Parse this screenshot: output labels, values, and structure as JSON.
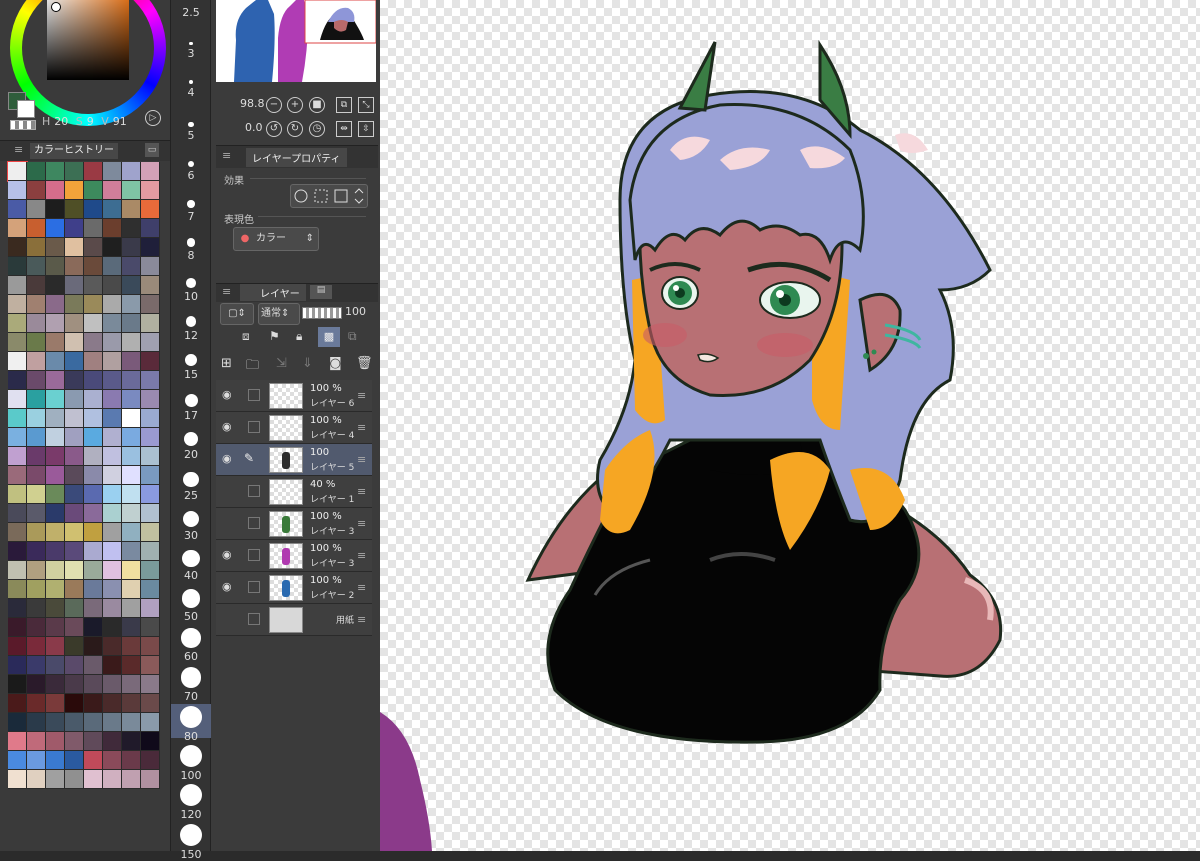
{
  "color_panel": {
    "h_label": "H",
    "h_value": "20",
    "s_label": "S",
    "s_value": "9",
    "v_label": "V",
    "v_value": "91",
    "fg_color": "#2f5d3b",
    "bg_color": "#ffffff"
  },
  "color_history": {
    "tab_label": "カラーヒストリー",
    "swatches": [
      "#eeeeee",
      "#2c6a4a",
      "#3e8760",
      "#3c6f54",
      "#9a3a44",
      "#7e8a9c",
      "#9fa3cc",
      "#d3a1b7",
      "#b6c0e8",
      "#8b3f3f",
      "#d56d8b",
      "#f2a33a",
      "#3d8a5d",
      "#d07e9a",
      "#7fc3a5",
      "#e29aa1",
      "#4a5ba6",
      "#888888",
      "#1d1d1d",
      "#4f4f26",
      "#1f4a8a",
      "#3d6d92",
      "#aa8a66",
      "#e86a3a",
      "#d4a27a",
      "#c85f2f",
      "#2b6ee3",
      "#3f3f8a",
      "#6a6a6a",
      "#6b3e2d",
      "#2f2f2f",
      "#3f3f6a",
      "#3a2a1f",
      "#8a6f3a",
      "#6a5a4a",
      "#e0c0a0",
      "#5a4a4a",
      "#1f1f1f",
      "#3a3a4a",
      "#1f1f3a",
      "#2a3a3a",
      "#4a5a5a",
      "#5a5a4a",
      "#8a6a5a",
      "#6a4a3a",
      "#5a6a7a",
      "#4a4a6a",
      "#8a8a9a",
      "#9a9a9a",
      "#4a3a3a",
      "#2a2a2a",
      "#6a6a7a",
      "#5a5a5a",
      "#4a4a4a",
      "#3a4a5a",
      "#9a8a7a",
      "#c0b0a0",
      "#a08070",
      "#8a6a8a",
      "#7a7a5a",
      "#9a8a5a",
      "#aaaaaa",
      "#8a9aaa",
      "#7a6a6a",
      "#aaaa7a",
      "#9a8a9a",
      "#b0a0b0",
      "#a09080",
      "#c0c0c0",
      "#7a8a9a",
      "#6a7a8a",
      "#b0b0a0",
      "#8a8a6a",
      "#6a7a4a",
      "#9a7a6a",
      "#d0c0b0",
      "#8a7a8a",
      "#9a9aaa",
      "#b0b0b0",
      "#a0a0b0",
      "#f0f0f0",
      "#c0a0a0",
      "#6a8aaa",
      "#3a6aa0",
      "#a08080",
      "#b0a0a0",
      "#7a5a7a",
      "#5a2a3a",
      "#2a2a4a",
      "#6a4a6a",
      "#9a6a9a",
      "#3a3a5a",
      "#4a4a7a",
      "#5a5a8a",
      "#6a6a9a",
      "#7a7aaa",
      "#e0e0f0",
      "#2aa0a0",
      "#6ad0d0",
      "#8a9ab0",
      "#aab0d0",
      "#8a7ab0",
      "#7a8ac0",
      "#9a8ab0",
      "#5acaca",
      "#9ad0e0",
      "#a0b0c0",
      "#c0c0d0",
      "#b0c0e0",
      "#5a7ab0",
      "#ffffff",
      "#9aaad0",
      "#7ab0e0",
      "#5a9ad0",
      "#c0d0e0",
      "#a0a0c0",
      "#5aaae0",
      "#b0b0d0",
      "#7aaae0",
      "#9a9ad0",
      "#c0a0d0",
      "#6a3a6a",
      "#7a3a6a",
      "#8a5a8a",
      "#b0b0c0",
      "#c0c0e0",
      "#9ac0e0",
      "#aac0d0",
      "#9a6a7a",
      "#7a4a6a",
      "#9a5a9a",
      "#5a4a5a",
      "#8a8aaa",
      "#d0d0e0",
      "#e0e0ff",
      "#7a9ac0",
      "#c0c080",
      "#d0d090",
      "#6a8a5a",
      "#3a4a7a",
      "#5a6ab0",
      "#9ad0f0",
      "#c0e0f0",
      "#8a9ae0",
      "#4a4a5a",
      "#5a5a6a",
      "#2a3a6a",
      "#6a4a7a",
      "#8a6a9a",
      "#aad0d0",
      "#c0d0d0",
      "#b0c0d0",
      "#7a6a5a",
      "#aa9a5a",
      "#c0b06a",
      "#d0c070",
      "#c0a040",
      "#a0a0a0",
      "#90b0c0",
      "#c0c0a0",
      "#2a1a3a",
      "#3a2a5a",
      "#4a3a6a",
      "#5a4a7a",
      "#aaaad0",
      "#c0c0f0",
      "#7a8aa0",
      "#a0b0b0",
      "#c0c0b0",
      "#b0a080",
      "#d0d0a0",
      "#e0e0b0",
      "#9aaa9a",
      "#e0c0e0",
      "#f0e0a0",
      "#7a9a9a",
      "#8a8a5a",
      "#a0a060",
      "#b0b070",
      "#9a7a5a",
      "#6a7a9a",
      "#8a90b0",
      "#e0d0b0",
      "#6a8aa0",
      "#2a2a3a",
      "#3a3a3a",
      "#4a4a3a",
      "#5a6a5a",
      "#7a6a7a",
      "#9a8aa0",
      "#a0a0a0",
      "#b0a0c0",
      "#3a1a2a",
      "#4a2a3a",
      "#5a3a4a",
      "#6a4a5a",
      "#1a1a2a",
      "#2a2a2a",
      "#3a3a4a",
      "#4a4a4a",
      "#5a1a2a",
      "#7a2a3a",
      "#8a3a4a",
      "#3a3a2a",
      "#2a1a1a",
      "#4a2a2a",
      "#6a3a3a",
      "#7a4a4a",
      "#2a2a5a",
      "#3a3a6a",
      "#4a4a6a",
      "#5a4a6a",
      "#6a5a6a",
      "#3a1a1a",
      "#5a2a2a",
      "#8a5a5a",
      "#1a1a1a",
      "#2a1a2a",
      "#3a2a3a",
      "#4a3a4a",
      "#5a4a5a",
      "#6a5a6a",
      "#7a6a7a",
      "#8a7a8a",
      "#4a1a1a",
      "#6a2a2a",
      "#7a3a3a",
      "#2a0a0a",
      "#3a1a1a",
      "#4a2a2a",
      "#5a3a3a",
      "#6a4a4a",
      "#1a2a3a",
      "#2a3a4a",
      "#3a4a5a",
      "#4a5a6a",
      "#5a6a7a",
      "#6a7a8a",
      "#7a8a9a",
      "#8a9aaa",
      "#e07a8a",
      "#c06a7a",
      "#a05a6a",
      "#805a6a",
      "#604a5a",
      "#402a3a",
      "#201a2a",
      "#100a1a",
      "#4a8ae0",
      "#6a9ae0",
      "#3a7ad0",
      "#2a5aa0",
      "#c04a5a",
      "#8a4a5a",
      "#6a3a4a",
      "#4a2a3a",
      "#f0e0d0",
      "#e0d0c0",
      "#a0a0a0",
      "#909090",
      "#e0c0d0",
      "#d0b0c0",
      "#c0a0b0",
      "#b090a0"
    ]
  },
  "brush_sizes": [
    "2.5",
    "3",
    "4",
    "5",
    "6",
    "7",
    "8",
    "10",
    "12",
    "15",
    "17",
    "20",
    "25",
    "30",
    "40",
    "50",
    "60",
    "70",
    "80",
    "100",
    "120",
    "150"
  ],
  "brush_selected": "80",
  "navigator": {
    "zoom": "98.8",
    "rotation": "0.0"
  },
  "layer_property": {
    "title": "レイヤープロパティ",
    "effect_label": "効果",
    "color_label": "表現色",
    "color_value": "カラー"
  },
  "layer_panel": {
    "tab_label": "レイヤー",
    "blend_mode": "通常",
    "opacity": "100",
    "layers": [
      {
        "pct": "100 %",
        "name": "レイヤー 6",
        "visible": true,
        "active": false,
        "fig": ""
      },
      {
        "pct": "100 %",
        "name": "レイヤー 4",
        "visible": true,
        "active": false,
        "fig": ""
      },
      {
        "pct": "100",
        "name": "レイヤー 5",
        "visible": true,
        "active": true,
        "fig": "#2a2a2a"
      },
      {
        "pct": "40 %",
        "name": "レイヤー 1",
        "visible": false,
        "active": false,
        "fig": ""
      },
      {
        "pct": "100 %",
        "name": "レイヤー 3",
        "visible": false,
        "active": false,
        "fig": "#3a7a3a"
      },
      {
        "pct": "100 %",
        "name": "レイヤー 3",
        "visible": true,
        "active": false,
        "fig": "#b03ab0"
      },
      {
        "pct": "100 %",
        "name": "レイヤー 2",
        "visible": true,
        "active": false,
        "fig": "#2a6ab0"
      },
      {
        "pct": "",
        "name": "用紙",
        "visible": false,
        "active": false,
        "fig": ""
      }
    ]
  }
}
